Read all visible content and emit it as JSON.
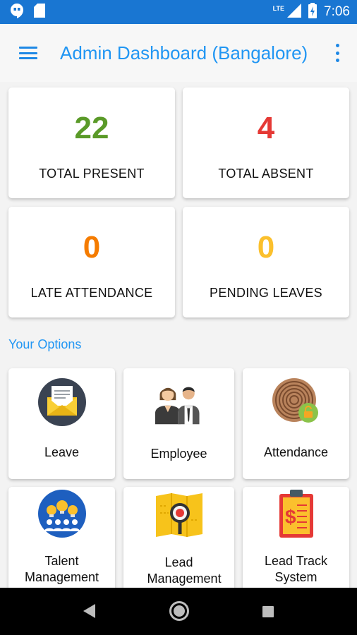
{
  "status_bar": {
    "time": "7:06",
    "network": "LTE"
  },
  "app_bar": {
    "title": "Admin Dashboard (Bangalore)"
  },
  "stats": [
    {
      "value": "22",
      "label": "TOTAL PRESENT",
      "color": "#5a9a28"
    },
    {
      "value": "4",
      "label": "TOTAL ABSENT",
      "color": "#e53935"
    },
    {
      "value": "0",
      "label": "LATE ATTENDANCE",
      "color": "#f57c00"
    },
    {
      "value": "0",
      "label": "PENDING LEAVES",
      "color": "#fbc02d"
    }
  ],
  "options_title": "Your Options",
  "options": [
    {
      "label": "Leave",
      "icon": "envelope-icon"
    },
    {
      "label": "Employee",
      "icon": "employees-icon"
    },
    {
      "label": "Attendance",
      "icon": "fingerprint-icon"
    },
    {
      "label": "Talent Management",
      "icon": "lightbulb-team-icon"
    },
    {
      "label": "Lead Management",
      "icon": "map-search-icon"
    },
    {
      "label": "Lead Track System",
      "icon": "clipboard-dollar-icon"
    }
  ],
  "colors": {
    "primary": "#2196f3",
    "status_bar": "#1976d2",
    "background": "#f3f3f3"
  }
}
